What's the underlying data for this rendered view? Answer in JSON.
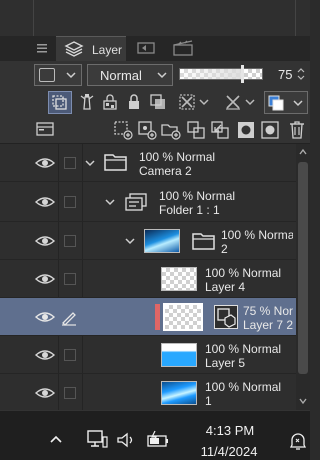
{
  "tabs": {
    "layer_label": "Layer"
  },
  "blending": {
    "mode": "Normal",
    "opacity_value": "75",
    "opacity_fraction": 0.75
  },
  "colors": {
    "selected_row": "#5f6f8e",
    "accent_blue": "#3b7fd6",
    "clip_red": "#e06666"
  },
  "layers": [
    {
      "line1": "100 % Normal",
      "line2": "Camera 2",
      "type": "folder"
    },
    {
      "line1": "100 % Normal",
      "line2": "Folder 1 : 1",
      "type": "folder"
    },
    {
      "line1": "100 % Norma",
      "line2": "2",
      "type": "folder"
    },
    {
      "line1": "100 % Normal",
      "line2": "Layer 4",
      "type": "raster"
    },
    {
      "line1": "75 % Nor",
      "line2": "Layer 7 2",
      "type": "raster",
      "selected": true
    },
    {
      "line1": "100 % Normal",
      "line2": "Layer 5",
      "type": "raster"
    },
    {
      "line1": "100 % Normal",
      "line2": "1",
      "type": "raster"
    }
  ],
  "taskbar": {
    "time": "4:13 PM",
    "date": "11/4/2024"
  }
}
